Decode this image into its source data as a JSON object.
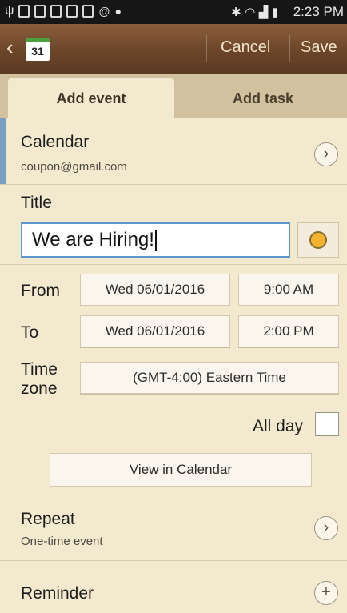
{
  "status_bar": {
    "time": "2:23 PM"
  },
  "app_bar": {
    "calendar_icon_day": "31",
    "cancel_label": "Cancel",
    "save_label": "Save"
  },
  "tabs": [
    {
      "label": "Add event",
      "active": true
    },
    {
      "label": "Add task",
      "active": false
    }
  ],
  "calendar": {
    "label": "Calendar",
    "account": "coupon@gmail.com"
  },
  "title": {
    "label": "Title",
    "value": "We are Hiring!"
  },
  "from": {
    "label": "From",
    "date": "Wed 06/01/2016",
    "time": "9:00  AM"
  },
  "to": {
    "label": "To",
    "date": "Wed 06/01/2016",
    "time": "2:00  PM"
  },
  "timezone": {
    "label_line1": "Time",
    "label_line2": "zone",
    "value": "(GMT-4:00) Eastern Time"
  },
  "all_day": {
    "label": "All day",
    "checked": false
  },
  "view_in_calendar_label": "View in Calendar",
  "repeat": {
    "label": "Repeat",
    "value": "One-time event"
  },
  "reminder": {
    "label": "Reminder"
  },
  "colors": {
    "background": "#f3e9cf",
    "app_bar": "#6c4529",
    "input_border": "#5a9ad1",
    "calendar_accent": "#7a9fc0"
  }
}
